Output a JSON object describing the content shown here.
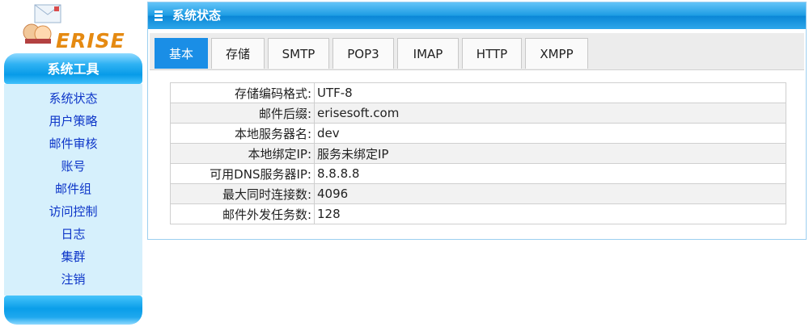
{
  "logo": {
    "text": "ERISE"
  },
  "sidebar": {
    "title": "系统工具",
    "items": [
      {
        "label": "系统状态"
      },
      {
        "label": "用户策略"
      },
      {
        "label": "邮件审核"
      },
      {
        "label": "账号"
      },
      {
        "label": "邮件组"
      },
      {
        "label": "访问控制"
      },
      {
        "label": "日志"
      },
      {
        "label": "集群"
      },
      {
        "label": "注销"
      }
    ]
  },
  "panel": {
    "title": "系统状态"
  },
  "tabs": [
    {
      "label": "基本",
      "active": true
    },
    {
      "label": "存储"
    },
    {
      "label": "SMTP"
    },
    {
      "label": "POP3"
    },
    {
      "label": "IMAP"
    },
    {
      "label": "HTTP"
    },
    {
      "label": "XMPP"
    }
  ],
  "status": [
    {
      "key": "存储编码格式:",
      "value": "UTF-8"
    },
    {
      "key": "邮件后缀:",
      "value": "erisesoft.com"
    },
    {
      "key": "本地服务器名:",
      "value": "dev"
    },
    {
      "key": "本地绑定IP:",
      "value": "服务未绑定IP"
    },
    {
      "key": "可用DNS服务器IP:",
      "value": "8.8.8.8"
    },
    {
      "key": "最大同时连接数:",
      "value": "4096"
    },
    {
      "key": "邮件外发任务数:",
      "value": "128"
    }
  ],
  "colors": {
    "accent": "#1a8ee6",
    "menu_link": "#0c35c8",
    "logo": "#e58a12",
    "menu_bg": "#d6f0fc"
  }
}
